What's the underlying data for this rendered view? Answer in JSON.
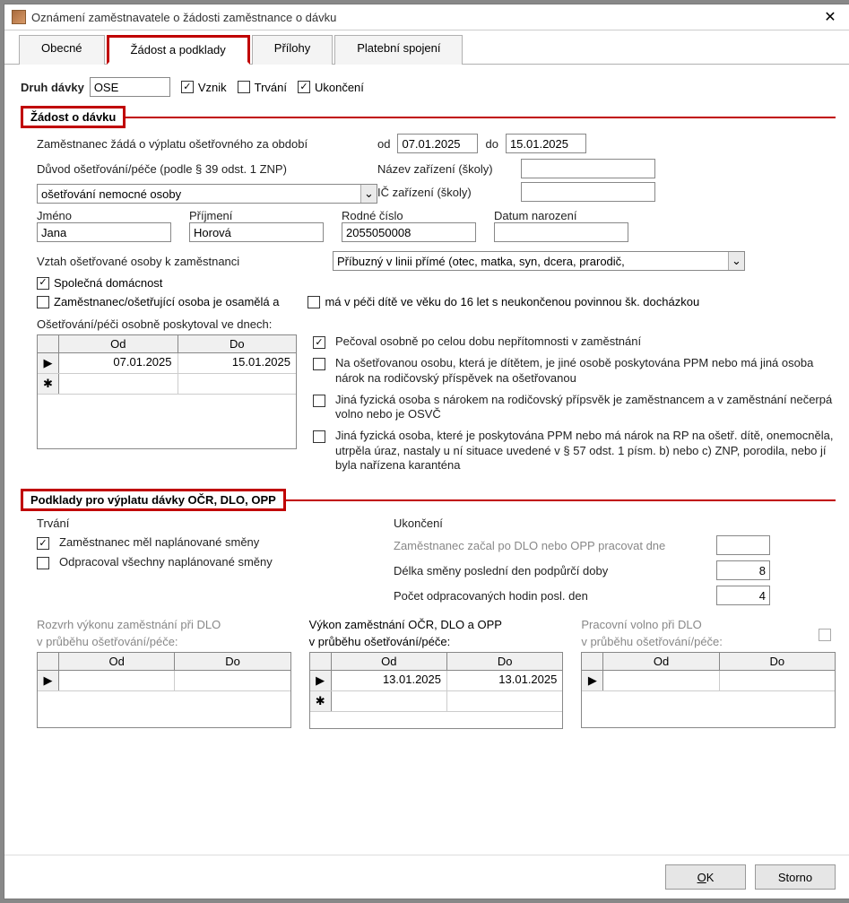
{
  "window": {
    "title": "Oznámení zaměstnavatele o žádosti zaměstnance o dávku"
  },
  "tabs": [
    "Obecné",
    "Žádost a podklady",
    "Přílohy",
    "Platební spojení"
  ],
  "druh_davky_label": "Druh dávky",
  "druh_davky_value": "OSE",
  "vznik": "Vznik",
  "trvani": "Trvání",
  "ukonceni": "Ukončení",
  "section1": "Žádost o dávku",
  "req": {
    "line1": "Zaměstnanec žádá o výplatu ošetřovného za období",
    "od_lbl": "od",
    "od_val": "07.01.2025",
    "do_lbl": "do",
    "do_val": "15.01.2025",
    "duvod_lbl": "Důvod ošetřování/péče (podle § 39 odst. 1 ZNP)",
    "duvod_val": "ošetřování nemocné osoby",
    "nazev_zar_lbl": "Název zařízení (školy)",
    "ic_zar_lbl": "IČ zařízení (školy)",
    "jmeno_lbl": "Jméno",
    "jmeno_val": "Jana",
    "prijmeni_lbl": "Příjmení",
    "prijmeni_val": "Horová",
    "rc_lbl": "Rodné číslo",
    "rc_val": "2055050008",
    "dn_lbl": "Datum narození",
    "vztah_lbl": "Vztah ošetřované osoby k zaměstnanci",
    "vztah_val": "Příbuzný v linii přímé (otec, matka, syn, dcera, prarodič,",
    "spol_dom": "Společná domácnost",
    "osamela": "Zaměstnanec/ošetřující osoba je osamělá a",
    "dite16": "má v péči dítě ve věku do 16 let s neukončenou povinnou šk. docházkou",
    "osobne_lbl": "Ošetřování/péči osobně poskytoval ve dnech:",
    "tbl_od": "Od",
    "tbl_do": "Do",
    "tbl_rows": [
      {
        "od": "07.01.2025",
        "do": "15.01.2025"
      }
    ],
    "c1": "Pečoval osobně po celou dobu nepřítomnosti v zaměstnání",
    "c2": "Na ošetřovanou osobu, která je dítětem, je jiné osobě poskytována PPM nebo má jiná osoba nárok na rodičovský příspěvek na ošetřovanou",
    "c3": "Jiná fyzická osoba s nárokem na rodičovský přípsvěk je zaměstnancem a v zaměstnání nečerpá volno nebo je OSVČ",
    "c4": "Jiná fyzická osoba, které je poskytována PPM nebo má nárok na RP na ošetř. dítě, onemocněla, utrpěla úraz, nastaly u ní situace uvedené v § 57 odst. 1 písm. b) nebo c) ZNP, porodila, nebo jí byla nařízena karanténa"
  },
  "section2": "Podklady pro výplatu dávky OČR, DLO, OPP",
  "pod": {
    "trvani_lbl": "Trvání",
    "plan": "Zaměstnanec měl naplánované směny",
    "odpr": "Odpracoval všechny naplánované směny",
    "ukon_lbl": "Ukončení",
    "zac_dlo": "Zaměstnanec začal po DLO nebo OPP pracovat dne",
    "delka_lbl": "Délka směny poslední den podpůrčí doby",
    "delka_val": "8",
    "pocet_lbl": "Počet odpracovaných hodin posl. den",
    "pocet_val": "4",
    "t1_lbl1": "Rozvrh výkonu zaměstnání při DLO",
    "t1_lbl2": "v průběhu ošetřování/péče:",
    "t2_lbl1": "Výkon zaměstnání OČR, DLO a OPP",
    "t2_lbl2": "v průběhu ošetřování/péče:",
    "t2_rows": [
      {
        "od": "13.01.2025",
        "do": "13.01.2025"
      }
    ],
    "t3_lbl1": "Pracovní volno při DLO",
    "t3_lbl2": "v průběhu ošetřování/péče:"
  },
  "buttons": {
    "ok": "OK",
    "storno": "Storno"
  },
  "marks": {
    "check": "✓",
    "arrow": "▶",
    "star": "✱",
    "down": "⌄"
  }
}
